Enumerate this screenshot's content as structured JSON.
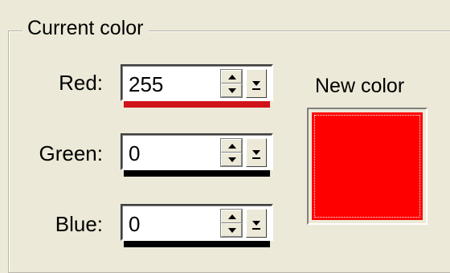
{
  "group": {
    "title": "Current color"
  },
  "fields": [
    {
      "label": "Red:",
      "value": "255",
      "level": 1.0,
      "bar_color": "#d0121a"
    },
    {
      "label": "Green:",
      "value": "0",
      "level": 1.0,
      "bar_color": "#000000"
    },
    {
      "label": "Blue:",
      "value": "0",
      "level": 1.0,
      "bar_color": "#000000"
    }
  ],
  "preview": {
    "label": "New color",
    "color": "#ff0000"
  },
  "icons": {
    "spin_up": "spin-up-icon",
    "spin_down": "spin-down-icon",
    "dropdown": "dropdown-arrow-icon"
  }
}
